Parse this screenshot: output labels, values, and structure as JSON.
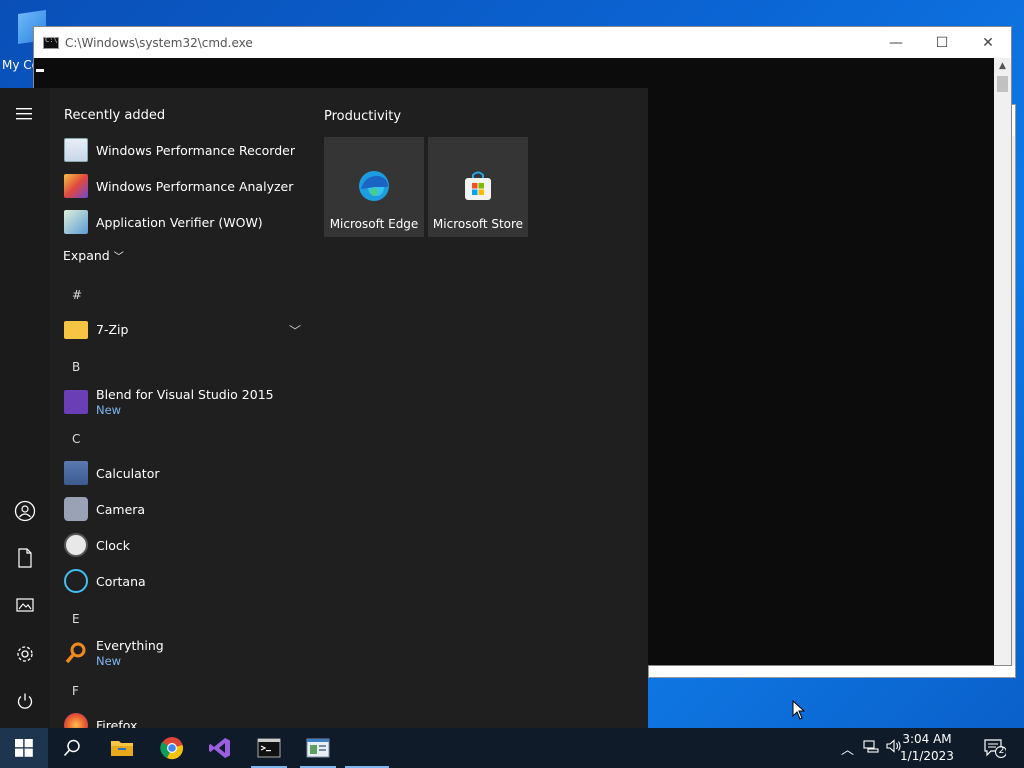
{
  "desktop": {
    "icon_label": "My Co"
  },
  "cmd_window": {
    "title": "C:\\Windows\\system32\\cmd.exe",
    "min": "—",
    "max": "☐",
    "close": "✕"
  },
  "cmd_window2": {
    "min": "—",
    "max": "☐",
    "close": "✕"
  },
  "start": {
    "recently_added_label": "Recently added",
    "recent": [
      {
        "label": "Windows Performance Recorder",
        "icon": "perf-recorder-icon"
      },
      {
        "label": "Windows Performance Analyzer",
        "icon": "perf-analyzer-icon"
      },
      {
        "label": "Application Verifier (WOW)",
        "icon": "app-verifier-icon"
      }
    ],
    "expand_label": "Expand",
    "letters": [
      "#",
      "B",
      "C",
      "E",
      "F"
    ],
    "apps": [
      {
        "label": "7-Zip",
        "sub": ""
      },
      {
        "label": "Blend for Visual Studio 2015",
        "sub": "New"
      },
      {
        "label": "Calculator",
        "sub": ""
      },
      {
        "label": "Camera",
        "sub": ""
      },
      {
        "label": "Clock",
        "sub": ""
      },
      {
        "label": "Cortana",
        "sub": ""
      },
      {
        "label": "Everything",
        "sub": "New"
      },
      {
        "label": "Firefox",
        "sub": ""
      }
    ],
    "tiles_group": "Productivity",
    "tiles": [
      {
        "label": "Microsoft Edge"
      },
      {
        "label": "Microsoft Store"
      }
    ]
  },
  "taskbar": {
    "time": "3:04 AM",
    "date": "1/1/2023",
    "notification_count": "2"
  },
  "colors": {
    "accent": "#0b67d6",
    "start_bg": "#1f1f1f",
    "taskbar_bg": "#101b2a",
    "link_blue": "#7eb6f0"
  }
}
